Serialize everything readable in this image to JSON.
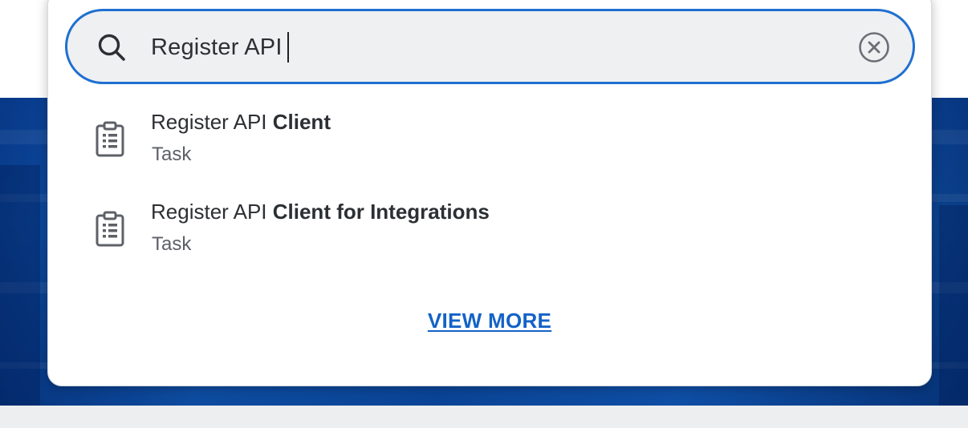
{
  "search": {
    "query": "Register API",
    "clear_icon": "clear-circle-x-icon",
    "search_icon": "search-icon"
  },
  "results": [
    {
      "title_match": "Register API",
      "title_rest": "Client",
      "type": "Task",
      "icon": "clipboard-list-icon"
    },
    {
      "title_match": "Register API",
      "title_rest": "Client for Integrations",
      "type": "Task",
      "icon": "clipboard-list-icon"
    }
  ],
  "view_more_label": "VIEW MORE",
  "colors": {
    "accent": "#1f6fd0",
    "link": "#1462c7",
    "banner": "#1463c4",
    "text": "#2c2f33",
    "muted": "#5d6167",
    "input_bg": "#eef0f2"
  }
}
